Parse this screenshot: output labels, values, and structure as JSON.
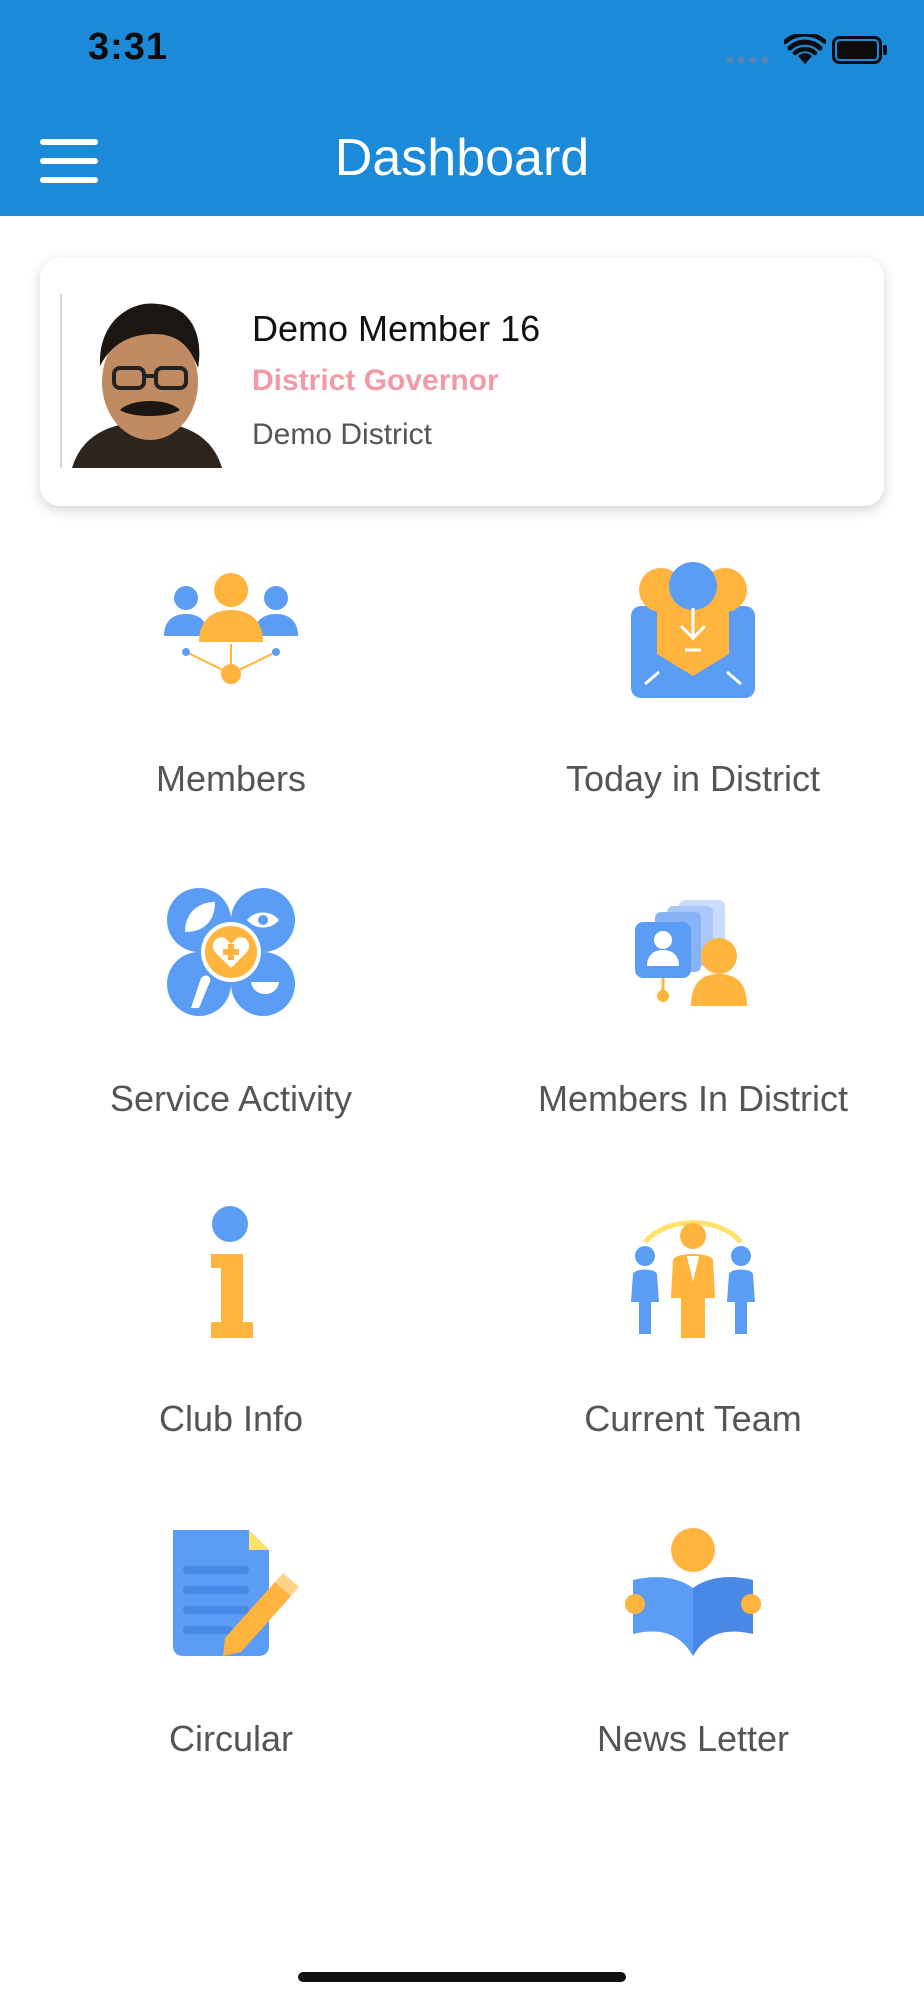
{
  "status_bar": {
    "time": "3:31"
  },
  "header": {
    "title": "Dashboard"
  },
  "profile": {
    "name": "Demo Member 16",
    "role": "District Governor",
    "district": "Demo District"
  },
  "tiles": [
    {
      "label": "Members",
      "icon": "members-network-icon"
    },
    {
      "label": "Today in District",
      "icon": "mail-envelope-icon"
    },
    {
      "label": "Service Activity",
      "icon": "service-activity-icon"
    },
    {
      "label": "Members In  District",
      "icon": "member-cards-icon"
    },
    {
      "label": "Club Info",
      "icon": "info-icon"
    },
    {
      "label": "Current Team",
      "icon": "team-icon"
    },
    {
      "label": "Circular",
      "icon": "document-edit-icon"
    },
    {
      "label": "News Letter",
      "icon": "reader-book-icon"
    }
  ],
  "colors": {
    "header": "#1a8ad9",
    "icon_blue": "#5b9cf5",
    "icon_orange": "#ffb43e",
    "role_pink": "#f29aa6"
  }
}
